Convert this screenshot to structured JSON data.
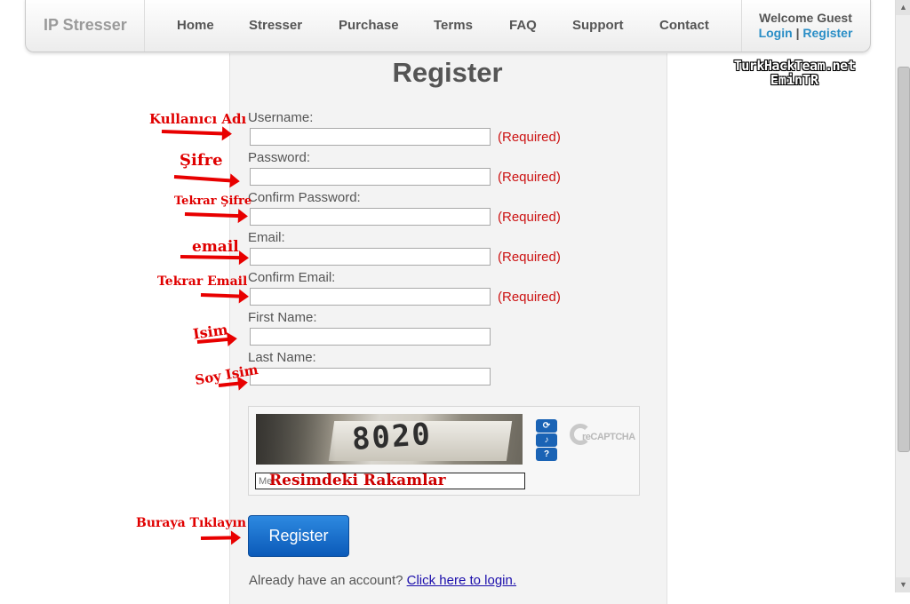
{
  "navbar": {
    "brand": "IP Stresser",
    "items": [
      "Home",
      "Stresser",
      "Purchase",
      "Terms",
      "FAQ",
      "Support",
      "Contact"
    ],
    "welcome": "Welcome Guest",
    "login": "Login",
    "separator": "|",
    "register": "Register"
  },
  "watermark": {
    "line1": "TurkHackTeam.net",
    "line2": "EminTR"
  },
  "form": {
    "title": "Register",
    "fields": [
      {
        "label": "Username:",
        "value": "",
        "required": "(Required)"
      },
      {
        "label": "Password:",
        "value": "",
        "required": "(Required)"
      },
      {
        "label": "Confirm Password:",
        "value": "",
        "required": "(Required)"
      },
      {
        "label": "Email:",
        "value": "",
        "required": "(Required)"
      },
      {
        "label": "Confirm Email:",
        "value": "",
        "required": "(Required)"
      },
      {
        "label": "First Name:",
        "value": ""
      },
      {
        "label": "Last Name:",
        "value": ""
      }
    ],
    "captcha": {
      "image_text": "8020",
      "input_placeholder": "Me",
      "logo_text": "reCAPTCHA",
      "buttons": [
        "reload-icon",
        "audio-icon",
        "help-icon"
      ]
    },
    "submit": "Register",
    "already_text": "Already have an account?",
    "login_link": "Click here to login."
  },
  "annotations": {
    "username": "Kullanıcı Adı",
    "password": "Şifre",
    "confirm_password": "Tekrar Şifre",
    "email": "email",
    "confirm_email": "Tekrar Email",
    "first_name": "Isim",
    "last_name": "Soy Isim",
    "captcha": "Resimdeki Rakamlar",
    "submit": "Buraya Tıklayın"
  },
  "colors": {
    "annotation_red": "#e00000",
    "required_red": "#cc1111",
    "link_blue": "#2a8ec6",
    "button_blue": "#0b5ab9"
  }
}
